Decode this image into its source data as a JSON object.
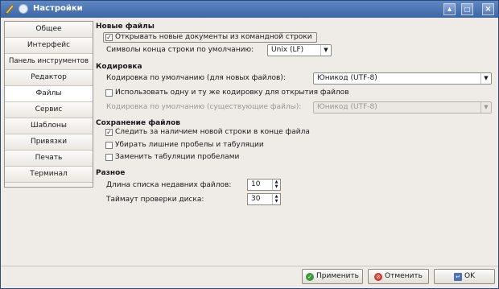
{
  "window": {
    "title": "Настройки",
    "colors": {
      "titlebar": "#4a72b0",
      "background": "#efebe7"
    }
  },
  "sidebar": {
    "items": [
      {
        "label": "Общее"
      },
      {
        "label": "Интерфейс"
      },
      {
        "label": "Панель инструментов"
      },
      {
        "label": "Редактор"
      },
      {
        "label": "Файлы",
        "selected": true
      },
      {
        "label": "Сервис"
      },
      {
        "label": "Шаблоны"
      },
      {
        "label": "Привязки"
      },
      {
        "label": "Печать"
      },
      {
        "label": "Терминал"
      }
    ]
  },
  "new_files": {
    "title": "Новые файлы",
    "open_new_docs": {
      "label": "Открывать новые документы из командной строки",
      "checked": true
    },
    "eol_label": "Символы конца строки по умолчанию:",
    "eol_value": "Unix (LF)"
  },
  "encoding": {
    "title": "Кодировка",
    "default_new_label": "Кодировка по умолчанию (для новых файлов):",
    "default_new_value": "Юникод (UTF-8)",
    "same_encoding": {
      "label": "Использовать одну и ту же кодировку для открытия файлов",
      "checked": false
    },
    "default_existing_label": "Кодировка по умолчанию (существующие файлы):",
    "default_existing_value": "Юникод (UTF-8)"
  },
  "saving": {
    "title": "Сохранение файлов",
    "track_newline": {
      "label": "Следить за наличием новой строки в конце файла",
      "checked": true
    },
    "strip_spaces": {
      "label": "Убирать лишние пробелы и табуляции",
      "checked": false
    },
    "replace_tabs": {
      "label": "Заменить табуляции пробелами",
      "checked": false
    }
  },
  "misc": {
    "title": "Разное",
    "recent_len_label": "Длина списка недавних файлов:",
    "recent_len_value": "10",
    "disk_check_label": "Таймаут проверки диска:",
    "disk_check_value": "30"
  },
  "buttons": {
    "apply": "Применить",
    "cancel": "Отменить",
    "ok": "OK"
  }
}
